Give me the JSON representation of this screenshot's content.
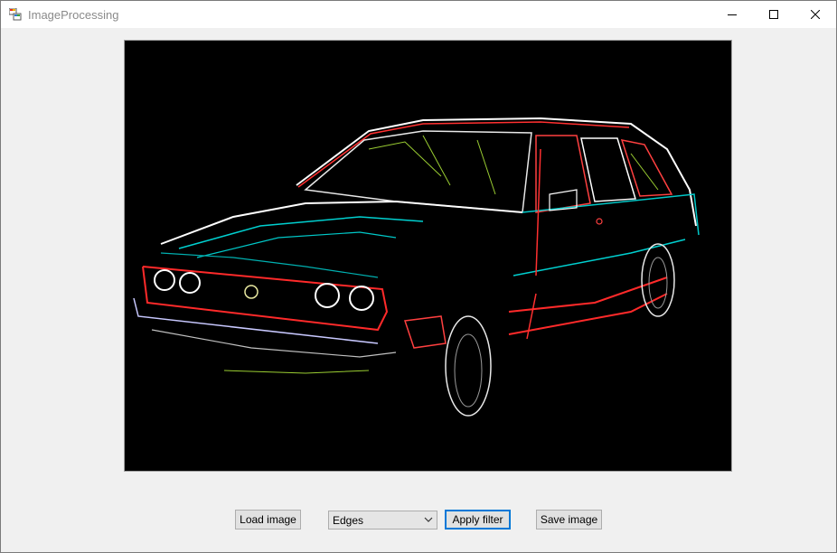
{
  "window": {
    "title": "ImageProcessing",
    "app_icon": "windows-forms-icon",
    "caption_buttons": [
      "minimize-icon",
      "maximize-icon",
      "close-icon"
    ]
  },
  "image": {
    "description_icon": "edge-detected-car-image",
    "background_color": "#000000"
  },
  "controls": {
    "load_label": "Load image",
    "filter_selected": "Edges",
    "apply_label": "Apply filter",
    "save_label": "Save image"
  },
  "colors": {
    "window_bg": "#f0f0f0",
    "focus_border": "#0078d7",
    "button_bg": "#e1e1e1"
  }
}
